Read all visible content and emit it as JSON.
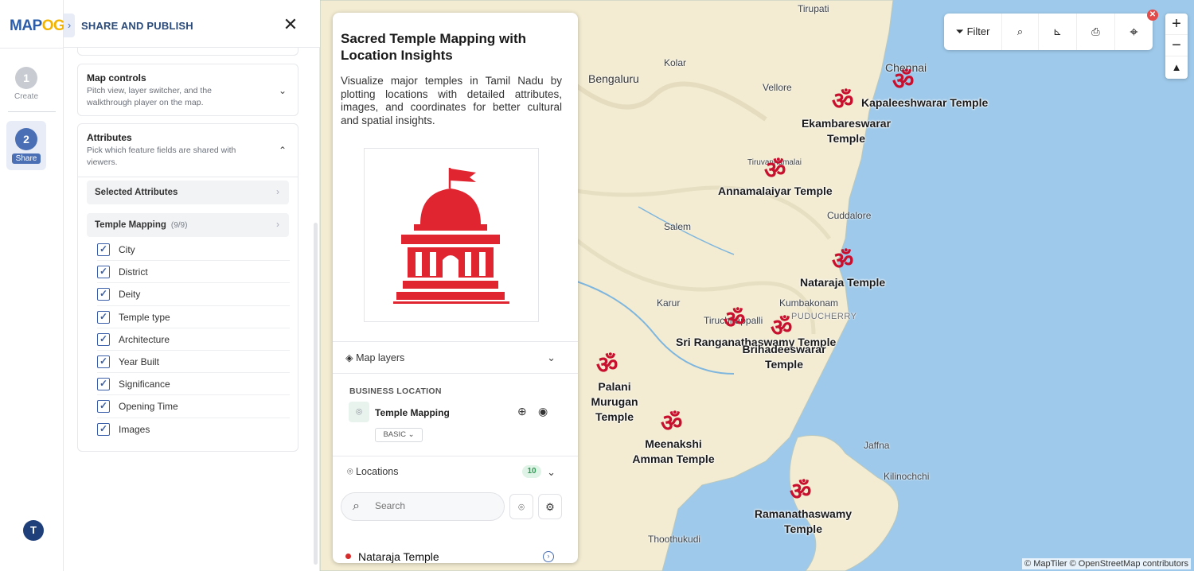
{
  "brand": {
    "logo_a": "MAP",
    "logo_b": "OG"
  },
  "rail": {
    "steps": [
      {
        "num": "1",
        "label": "Create"
      },
      {
        "num": "2",
        "label": "Share"
      }
    ],
    "avatar": "T"
  },
  "panel": {
    "title": "SHARE AND PUBLISH",
    "map_controls": {
      "title": "Map controls",
      "desc": "Pitch view, layer switcher, and the walkthrough player on the map."
    },
    "attributes": {
      "title": "Attributes",
      "desc": "Pick which feature fields are shared with viewers.",
      "selected_label": "Selected Attributes",
      "group_label": "Temple Mapping",
      "group_count": "(9/9)",
      "fields": [
        "City",
        "District",
        "Deity",
        "Temple type",
        "Architecture",
        "Year Built",
        "Significance",
        "Opening Time",
        "Images"
      ]
    }
  },
  "info": {
    "title": "Sacred Temple Mapping with Location Insights",
    "description": "Visualize major temples in Tamil Nadu by plotting locations with detailed attributes, images, and coordinates for better cultural and spatial insights.",
    "map_layers_label": "Map layers",
    "business_heading": "BUSINESS LOCATION",
    "layer_name": "Temple Mapping",
    "layer_style": "BASIC",
    "locations_label": "Locations",
    "locations_count": "10",
    "search_placeholder": "Search",
    "first_location": "Nataraja Temple"
  },
  "toolbar": {
    "filter_label": "Filter"
  },
  "map": {
    "places": [
      "Tirupati",
      "Kolar",
      "Bengaluru",
      "Vellore",
      "Chennai",
      "Tiruvannamalai",
      "Cuddalore",
      "Salem",
      "Kumbakonam",
      "PUDUCHERRY",
      "Karur",
      "Tiruchirappalli",
      "Jaffna",
      "Kilinochchi",
      "Thoothukudi"
    ],
    "temples": [
      "Kapaleeshwarar Temple",
      "Ekambareswarar Temple",
      "Annamalaiyar Temple",
      "Nataraja Temple",
      "Sri Ranganathaswamy Temple",
      "Brihadeeswarar Temple",
      "Palani Murugan Temple",
      "Meenakshi Amman Temple",
      "Ramanathaswamy Temple"
    ],
    "attribution": "© MapTiler © OpenStreetMap contributors"
  },
  "colors": {
    "accent": "#4a6fb5",
    "marker": "#c8102e",
    "water": "#9ec9ea",
    "land": "#f3ecd2"
  },
  "icons": [
    "close-icon",
    "chevron-right-icon",
    "chevron-down-icon",
    "chevron-up-icon",
    "filter-icon",
    "search-icon",
    "measure-icon",
    "print-icon",
    "locate-icon",
    "zoom-in-icon",
    "zoom-out-icon",
    "compass-icon",
    "layers-icon",
    "pin-icon",
    "zoom-to-icon",
    "eye-icon",
    "settings-sliders-icon",
    "om-marker-icon"
  ]
}
